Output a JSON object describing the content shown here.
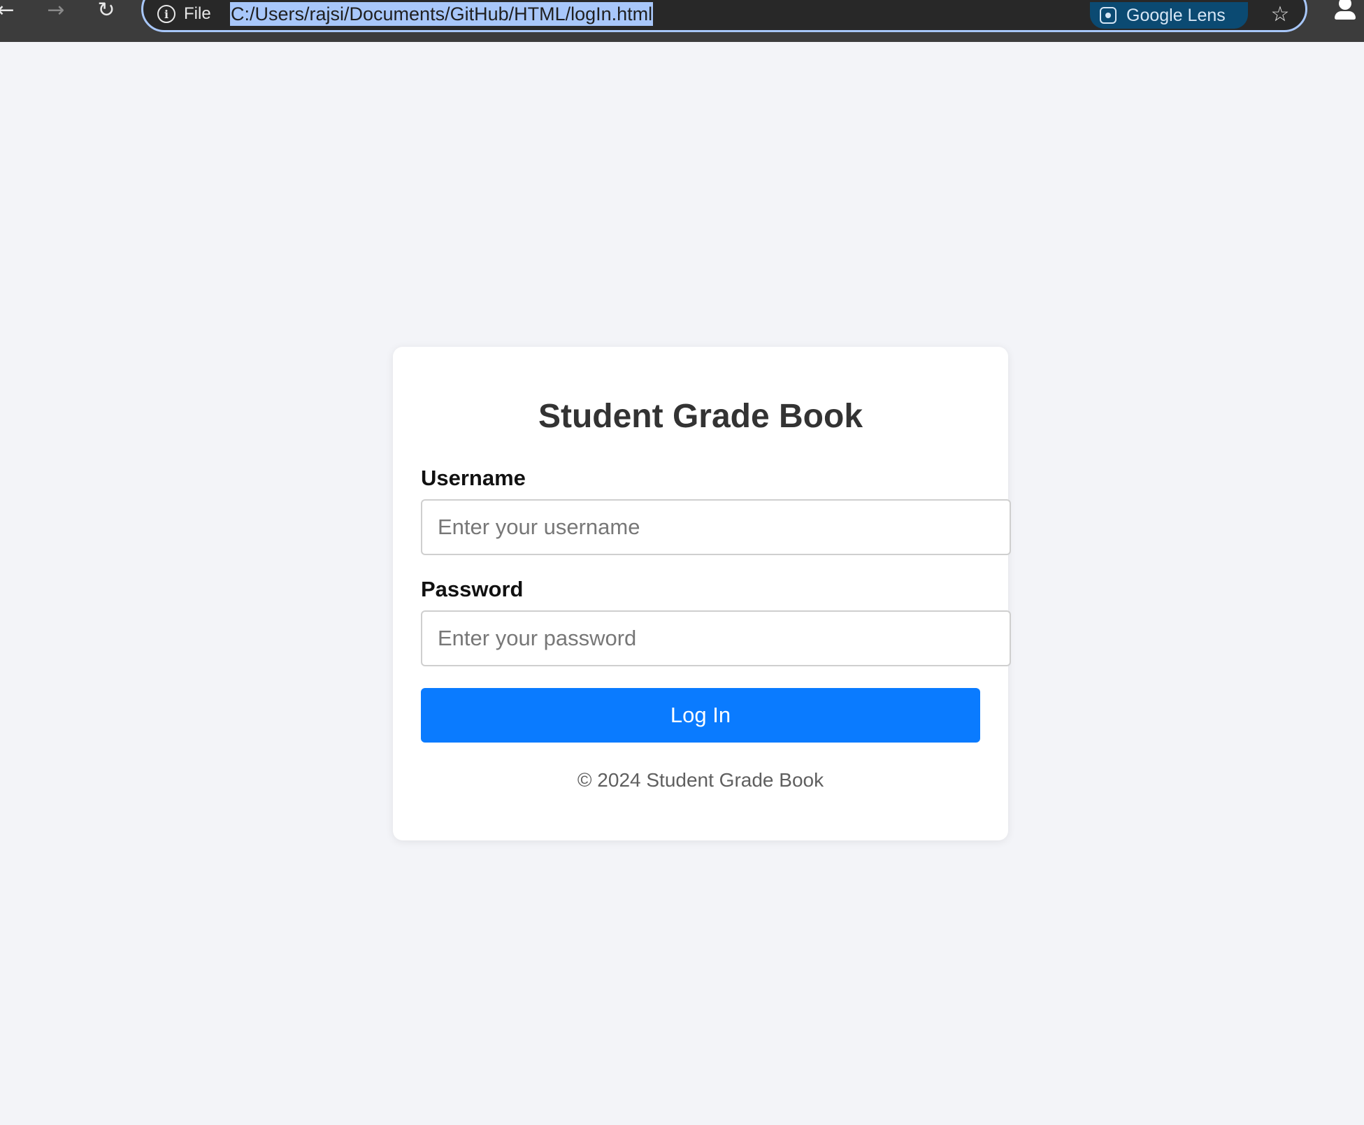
{
  "browser": {
    "back_icon": "arrow-left-icon",
    "forward_icon": "arrow-right-icon",
    "reload_icon": "reload-icon",
    "site_info_label": "File",
    "url": "C:/Users/rajsi/Documents/GitHub/HTML/logIn.html",
    "lens_label": "Google Lens",
    "bookmark_icon": "star-icon",
    "profile_icon": "profile-icon"
  },
  "login": {
    "title": "Student Grade Book",
    "username_label": "Username",
    "username_placeholder": "Enter your username",
    "password_label": "Password",
    "password_placeholder": "Enter your password",
    "submit_label": "Log In",
    "footer": "© 2024 Student Grade Book"
  },
  "colors": {
    "page_background": "#f3f4f8",
    "card_background": "#ffffff",
    "primary_button": "#0a7bff",
    "chrome_background": "#3c3c3c",
    "url_highlight": "#a8c7fa"
  }
}
